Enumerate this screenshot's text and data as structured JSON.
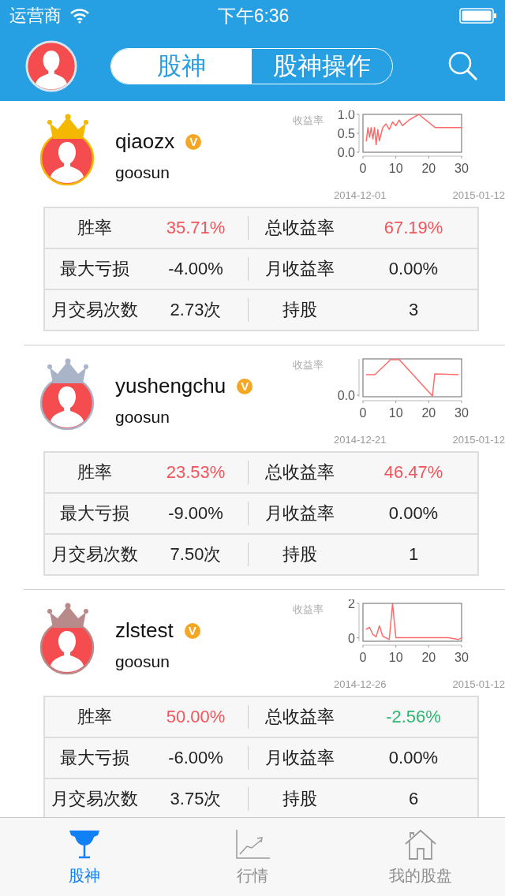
{
  "status_bar": {
    "carrier": "运营商",
    "time": "下午6:36"
  },
  "header": {
    "tabs": [
      {
        "label": "股神",
        "selected": true
      },
      {
        "label": "股神操作",
        "selected": false
      }
    ]
  },
  "traders": [
    {
      "name": "qiaozx",
      "badge": "V",
      "group": "goosun",
      "color": "#f5b800",
      "chart_label": "收益率",
      "start_date": "2014-12-01",
      "end_date": "2015-01-12",
      "chart_data": {
        "type": "line",
        "x": [
          1,
          1.5,
          2,
          2.5,
          3,
          3.5,
          4,
          4.5,
          5,
          6,
          7,
          8,
          9,
          10,
          11,
          12,
          14,
          17,
          22,
          30
        ],
        "series": [
          {
            "color": "#ff6b6b",
            "values": [
              0.3,
              0.65,
              0.4,
              0.65,
              0.35,
              0.65,
              0.2,
              0.6,
              0.3,
              0.65,
              0.75,
              0.6,
              0.8,
              0.7,
              0.85,
              0.7,
              0.85,
              1.0,
              0.65,
              0.65
            ]
          }
        ],
        "xlim": [
          0,
          30
        ],
        "ylim": [
          0,
          1
        ],
        "xticks": [
          0,
          10,
          20,
          30
        ],
        "yticks": [
          {
            "value": 0,
            "label": "0.0"
          },
          {
            "value": 0.5,
            "label": "0.5"
          },
          {
            "value": 1,
            "label": "1.0"
          }
        ]
      },
      "stats": [
        [
          {
            "label": "胜率",
            "value": "35.71%",
            "color": "#f5535a"
          },
          {
            "label": "总收益率",
            "value": "67.19%",
            "color": "#f5535a"
          }
        ],
        [
          {
            "label": "最大亏损",
            "value": "-4.00%",
            "color": "#222222"
          },
          {
            "label": "月收益率",
            "value": "0.00%",
            "color": "#222222"
          }
        ],
        [
          {
            "label": "月交易次数",
            "value": "2.73次",
            "color": "#222222"
          },
          {
            "label": "持股",
            "value": "3",
            "color": "#222222"
          }
        ]
      ]
    },
    {
      "name": "yushengchu",
      "badge": "V",
      "group": "goosun",
      "color": "#a9b4c8",
      "chart_label": "收益率",
      "start_date": "2014-12-21",
      "end_date": "2015-01-12",
      "sparkline": {
        "y_tick_label": "0.0",
        "x_tick_labels": [
          "0",
          "10",
          "20",
          "30"
        ]
      },
      "stats": [
        [
          {
            "label": "胜率",
            "value": "23.53%",
            "color": "#f5535a"
          },
          {
            "label": "总收益率",
            "value": "46.47%",
            "color": "#f5535a"
          }
        ],
        [
          {
            "label": "最大亏损",
            "value": "-9.00%",
            "color": "#222222"
          },
          {
            "label": "月收益率",
            "value": "0.00%",
            "color": "#222222"
          }
        ],
        [
          {
            "label": "月交易次数",
            "value": "7.50次",
            "color": "#222222"
          },
          {
            "label": "持股",
            "value": "1",
            "color": "#222222"
          }
        ]
      ]
    },
    {
      "name": "zlstest",
      "badge": "V",
      "group": "goosun",
      "color": "#b88a8a",
      "chart_label": "收益率",
      "start_date": "2014-12-26",
      "end_date": "2015-01-12",
      "chart_data": {
        "type": "line",
        "x": [
          1,
          2,
          3,
          4,
          5,
          6,
          8,
          9,
          10,
          12,
          20,
          26,
          29,
          30
        ],
        "series": [
          {
            "color": "#ff6b6b",
            "values": [
              0.5,
              0.6,
              0.2,
              0.05,
              0.7,
              0.1,
              -0.1,
              2,
              0,
              0,
              0,
              0,
              -0.1,
              0
            ]
          }
        ],
        "xlim": [
          0,
          30
        ],
        "ylim": [
          -0.2,
          2
        ],
        "xticks": [
          0,
          10,
          20,
          30
        ],
        "yticks": [
          0,
          2
        ]
      },
      "stats": [
        [
          {
            "label": "胜率",
            "value": "50.00%",
            "color": "#f5535a"
          },
          {
            "label": "总收益率",
            "value": "-2.56%",
            "color": "#2bb673"
          }
        ],
        [
          {
            "label": "最大亏损",
            "value": "-6.00%",
            "color": "#222222"
          },
          {
            "label": "月收益率",
            "value": "0.00%",
            "color": "#222222"
          }
        ],
        [
          {
            "label": "月交易次数",
            "value": "3.75次",
            "color": "#222222"
          },
          {
            "label": "持股",
            "value": "6",
            "color": "#222222"
          }
        ]
      ]
    }
  ],
  "tab_bar": [
    {
      "label": "股神",
      "kind": "trophy",
      "selected": true
    },
    {
      "label": "行情",
      "kind": "chart",
      "selected": false
    },
    {
      "label": "我的股盘",
      "kind": "home",
      "selected": false
    }
  ]
}
